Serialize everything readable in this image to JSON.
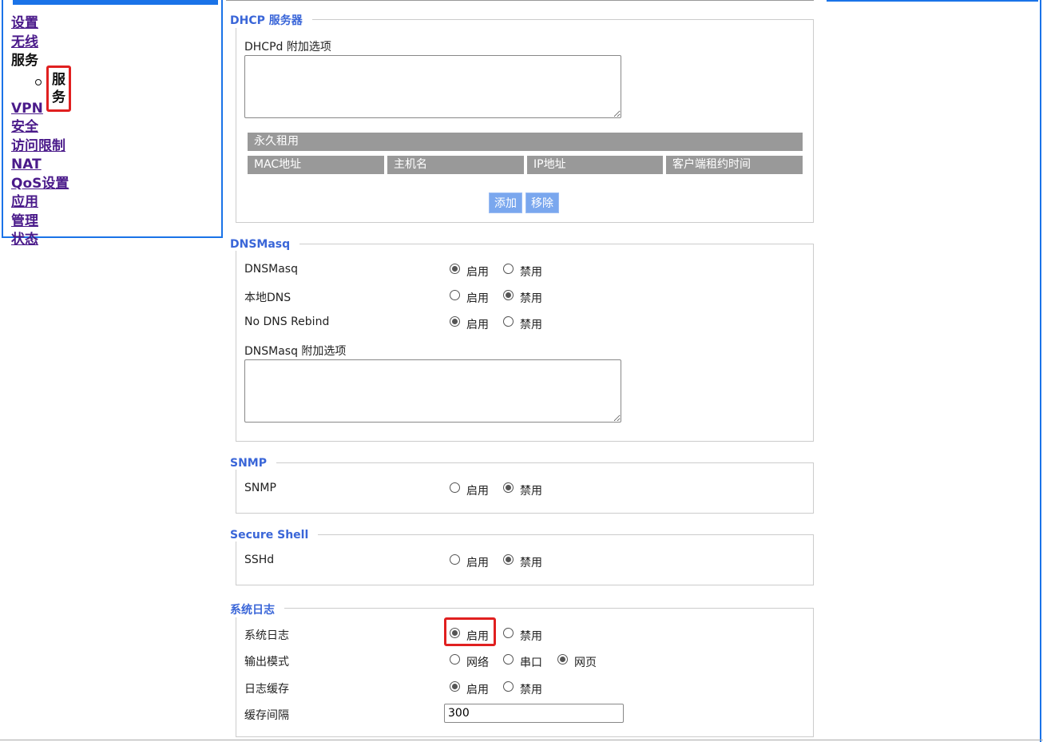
{
  "nav": {
    "items": [
      "设置",
      "无线",
      "服务"
    ],
    "current_sub": "服务",
    "items_after": [
      "VPN",
      "安全",
      "访问限制",
      "NAT",
      "QoS设置",
      "应用",
      "管理",
      "状态"
    ]
  },
  "dhcp": {
    "legend": "DHCP 服务器",
    "options_label": "DHCPd 附加选项",
    "table_title": "永久租用",
    "columns": [
      "MAC地址",
      "主机名",
      "IP地址",
      "客户端租约时间"
    ],
    "add_button": "添加",
    "remove_button": "移除"
  },
  "dnsmasq": {
    "legend": "DNSMasq",
    "rows": [
      {
        "label": "DNSMasq",
        "enable": "启用",
        "disable": "禁用",
        "selected": "enable"
      },
      {
        "label": "本地DNS",
        "enable": "启用",
        "disable": "禁用",
        "selected": "disable"
      },
      {
        "label": "No DNS Rebind",
        "enable": "启用",
        "disable": "禁用",
        "selected": "enable"
      }
    ],
    "options_label": "DNSMasq 附加选项"
  },
  "snmp": {
    "legend": "SNMP",
    "row": {
      "label": "SNMP",
      "enable": "启用",
      "disable": "禁用",
      "selected": "disable"
    }
  },
  "ssh": {
    "legend": "Secure Shell",
    "row": {
      "label": "SSHd",
      "enable": "启用",
      "disable": "禁用",
      "selected": "disable"
    }
  },
  "syslog": {
    "legend": "系统日志",
    "row_syslog": {
      "label": "系统日志",
      "enable": "启用",
      "disable": "禁用",
      "selected": "enable"
    },
    "row_output": {
      "label": "输出模式",
      "options": [
        "网络",
        "串口",
        "网页"
      ],
      "selected": "网页"
    },
    "row_cache": {
      "label": "日志缓存",
      "enable": "启用",
      "disable": "禁用",
      "selected": "enable"
    },
    "row_interval": {
      "label": "缓存间隔",
      "value": "300"
    }
  }
}
